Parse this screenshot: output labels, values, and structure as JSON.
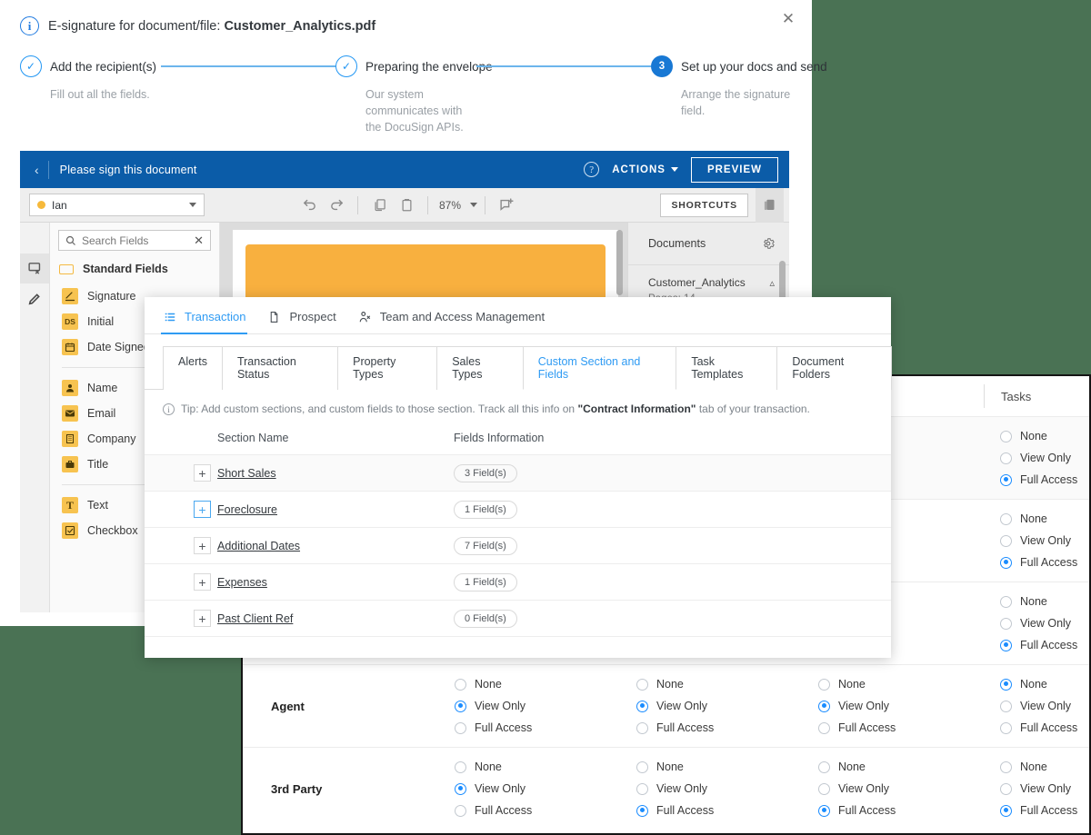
{
  "esign": {
    "info_icon": "info-icon",
    "title_prefix": "E-signature for document/file: ",
    "file_name": "Customer_Analytics.pdf",
    "close_label": "✕",
    "steps": [
      {
        "num": "✓",
        "state": "done",
        "label": "Add the recipient(s)",
        "desc": "Fill out all the fields."
      },
      {
        "num": "✓",
        "state": "done",
        "label": "Preparing the envelope",
        "desc": "Our system communicates with the DocuSign APIs."
      },
      {
        "num": "3",
        "state": "active",
        "label": "Set up your docs and send",
        "desc": "Arrange the signature field."
      }
    ]
  },
  "docusign": {
    "back_label": "‹",
    "bar_title": "Please sign this document",
    "help_label": "?",
    "actions_label": "ACTIONS",
    "preview_label": "PREVIEW",
    "recipient": "Ian",
    "zoom_level": "87%",
    "shortcuts_label": "SHORTCUTS",
    "search_placeholder": "Search Fields",
    "search_clear": "✕",
    "standard_fields_label": "Standard Fields",
    "fields_group_1": [
      {
        "label": "Signature",
        "icon": "signature-icon",
        "glyph": "✎"
      },
      {
        "label": "Initial",
        "icon": "initial-icon",
        "glyph": "DS"
      },
      {
        "label": "Date Signed",
        "icon": "calendar-icon",
        "glyph": "▦"
      }
    ],
    "fields_group_2": [
      {
        "label": "Name",
        "icon": "person-icon",
        "glyph": "●"
      },
      {
        "label": "Email",
        "icon": "envelope-icon",
        "glyph": "✉"
      },
      {
        "label": "Company",
        "icon": "building-icon",
        "glyph": "☷"
      },
      {
        "label": "Title",
        "icon": "briefcase-icon",
        "glyph": "▬"
      }
    ],
    "fields_group_3": [
      {
        "label": "Text",
        "icon": "text-icon",
        "glyph": "T"
      },
      {
        "label": "Checkbox",
        "icon": "checkbox-icon",
        "glyph": "☑"
      }
    ],
    "documents_panel": {
      "title": "Documents",
      "gear": "gear-icon",
      "doc_name": "Customer_Analytics",
      "pages_label": "Pages: 14"
    }
  },
  "transaction_modal": {
    "nav_tabs": [
      {
        "label": "Transaction",
        "icon": "list-icon",
        "active": true
      },
      {
        "label": "Prospect",
        "icon": "document-icon",
        "active": false
      },
      {
        "label": "Team and Access Management",
        "icon": "people-icon",
        "active": false
      }
    ],
    "sub_tabs": [
      {
        "label": "Alerts",
        "active": false
      },
      {
        "label": "Transaction Status",
        "active": false
      },
      {
        "label": "Property Types",
        "active": false
      },
      {
        "label": "Sales Types",
        "active": false
      },
      {
        "label": "Custom Section and Fields",
        "active": true
      },
      {
        "label": "Task Templates",
        "active": false
      },
      {
        "label": "Document Folders",
        "active": false
      }
    ],
    "tip_prefix": "Tip: Add custom sections, and custom fields to those section. Track all this info on ",
    "tip_bold": "\"Contract Information\"",
    "tip_suffix": " tab of your transaction.",
    "columns": [
      "Section Name",
      "Fields Information"
    ],
    "rows": [
      {
        "expand": "+",
        "name": "Short Sales",
        "fields": "3 Field(s)",
        "highlight": false
      },
      {
        "expand": "+",
        "name": "Foreclosure",
        "fields": "1 Field(s)",
        "highlight": true
      },
      {
        "expand": "+",
        "name": "Additional Dates",
        "fields": "7 Field(s)",
        "highlight": false
      },
      {
        "expand": "+",
        "name": "Expenses",
        "fields": "1 Field(s)",
        "highlight": false
      },
      {
        "expand": "+",
        "name": "Past Client Ref",
        "fields": "0 Field(s)",
        "highlight": false
      }
    ]
  },
  "permissions": {
    "visible_column_header": "Tasks",
    "options": [
      "None",
      "View Only",
      "Full Access"
    ],
    "rows": [
      {
        "label": "",
        "selections": [
          null,
          null,
          null,
          "Full Access"
        ],
        "alt": true
      },
      {
        "label": "",
        "selections": [
          null,
          null,
          null,
          "Full Access"
        ],
        "alt": false
      },
      {
        "label": "",
        "selections": [
          null,
          null,
          null,
          "Full Access"
        ],
        "alt": false
      },
      {
        "label": "Agent",
        "selections": [
          "View Only",
          "View Only",
          "View Only",
          "None"
        ],
        "alt": false
      },
      {
        "label": "3rd Party",
        "selections": [
          "View Only",
          "Full Access",
          "Full Access",
          "Full Access"
        ],
        "alt": false
      }
    ]
  },
  "colors": {
    "desktop_background": "#4a7254",
    "docusign_blue": "#0b5ca8",
    "accent_blue": "#2f9bf3",
    "radio_selected": "#1a8cff",
    "field_yellow": "#f7c350",
    "document_highlight": "#f8b03f"
  }
}
